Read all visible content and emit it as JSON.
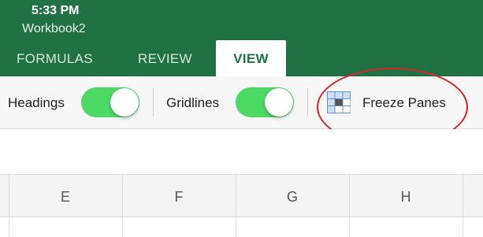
{
  "status": {
    "time": "5:33 PM"
  },
  "workbook": {
    "title": "Workbook2"
  },
  "tabs": [
    {
      "label": "FORMULAS"
    },
    {
      "label": "REVIEW"
    },
    {
      "label": "VIEW",
      "selected": true
    }
  ],
  "ribbon": {
    "headings": {
      "label": "Headings",
      "on": true
    },
    "gridlines": {
      "label": "Gridlines",
      "on": true
    },
    "freeze": {
      "label": "Freeze Panes",
      "icon": "freeze-panes-icon"
    }
  },
  "columns": [
    "E",
    "F",
    "G",
    "H"
  ],
  "colors": {
    "brand": "#207245",
    "toggle_on": "#4cd964",
    "annotation": "#d7262b"
  }
}
